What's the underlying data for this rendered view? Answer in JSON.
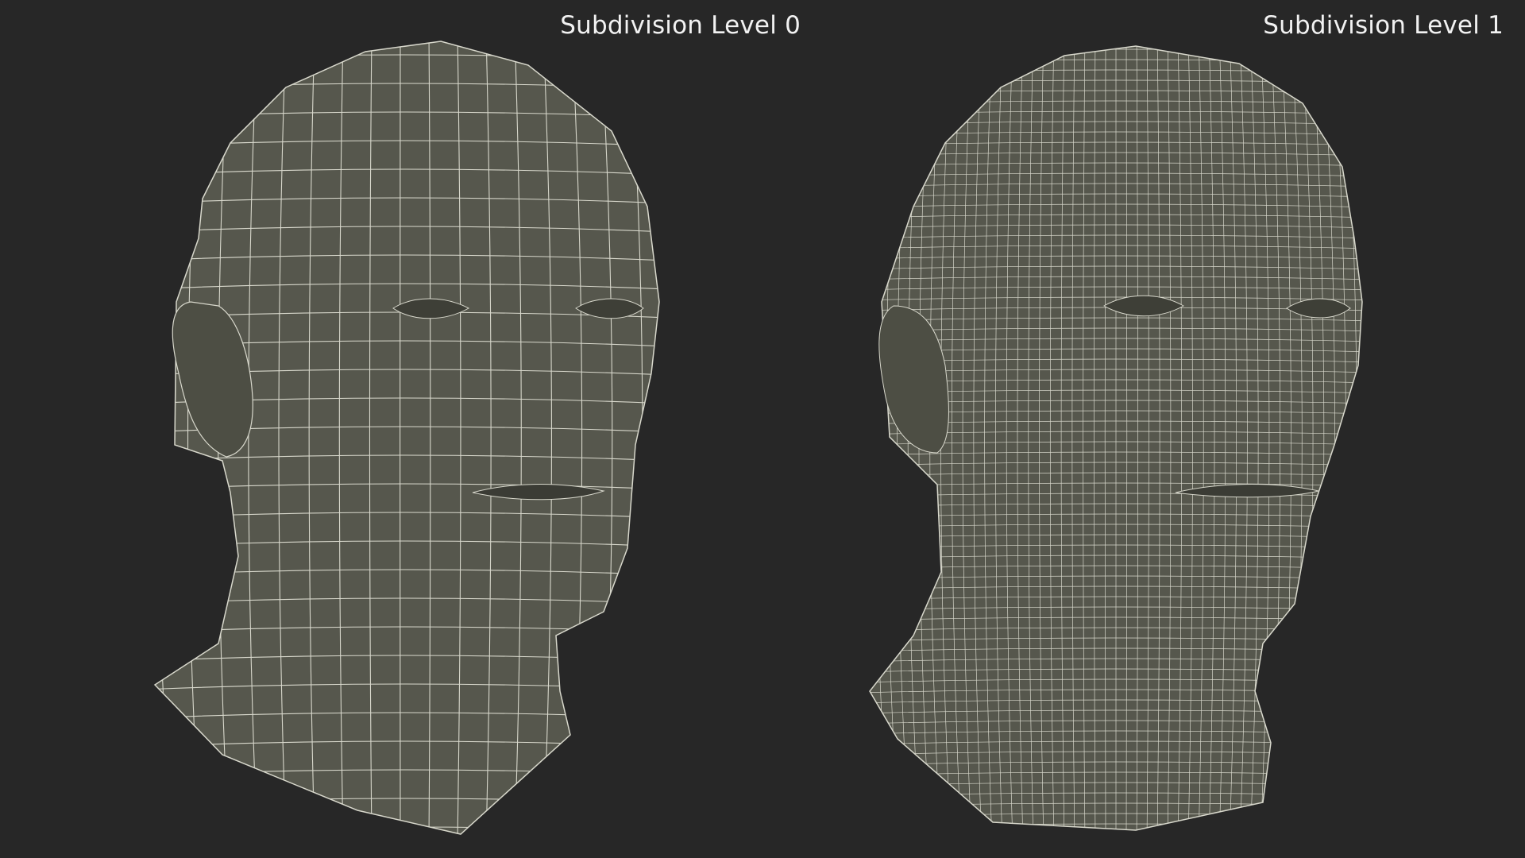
{
  "panels": [
    {
      "label": "Subdivision Level 0",
      "subject": "low-poly-head-wireframe"
    },
    {
      "label": "Subdivision Level 1",
      "subject": "subdivided-head-wireframe"
    }
  ],
  "colors": {
    "background": "#272727",
    "mesh_fill": "#56574d",
    "wire": "#d8d8cc",
    "label_text": "#f2f2f2"
  }
}
